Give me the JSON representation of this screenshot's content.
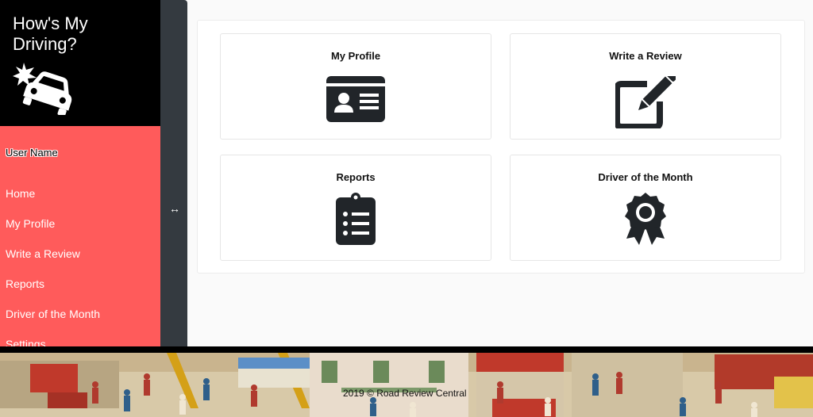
{
  "brand": {
    "title": "How's My Driving?",
    "logo_icon": "car-crash-icon"
  },
  "user": {
    "name": "User Name"
  },
  "nav": {
    "items": [
      {
        "label": "Home"
      },
      {
        "label": "My Profile"
      },
      {
        "label": "Write a Review"
      },
      {
        "label": "Reports"
      },
      {
        "label": "Driver of the Month"
      },
      {
        "label": "Settings"
      }
    ]
  },
  "toggle": {
    "glyph": "↔",
    "icon": "resize-horizontal-icon"
  },
  "cards": [
    {
      "title": "My Profile",
      "icon": "id-card-icon"
    },
    {
      "title": "Write a Review",
      "icon": "edit-icon"
    },
    {
      "title": "Reports",
      "icon": "clipboard-list-icon"
    },
    {
      "title": "Driver of the Month",
      "icon": "award-icon"
    }
  ],
  "footer": {
    "text": "2019 © Road Review Central"
  },
  "colors": {
    "sidebar": "#ff5b5b",
    "brand_bg": "#000000",
    "toggle_bar": "#343a40",
    "icon": "#212529"
  }
}
